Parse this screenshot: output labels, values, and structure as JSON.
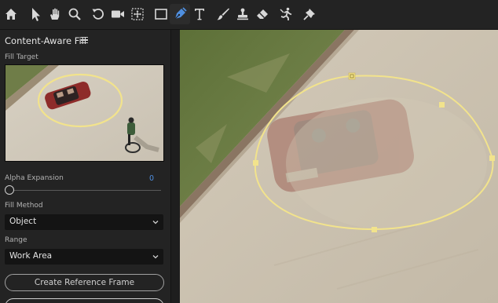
{
  "toolbar": {
    "tools": [
      {
        "name": "home-icon",
        "active": false
      },
      {
        "name": "selection-arrow-icon",
        "active": false
      },
      {
        "name": "hand-icon",
        "active": false
      },
      {
        "name": "zoom-icon",
        "active": false
      },
      {
        "name": "rotate-icon",
        "active": false
      },
      {
        "name": "camera-icon",
        "active": false
      },
      {
        "name": "pan-behind-icon",
        "active": false
      },
      {
        "name": "rectangle-icon",
        "active": false
      },
      {
        "name": "pen-icon",
        "active": true
      },
      {
        "name": "type-icon",
        "active": false
      },
      {
        "name": "brush-icon",
        "active": false
      },
      {
        "name": "clone-stamp-icon",
        "active": false
      },
      {
        "name": "eraser-icon",
        "active": false
      },
      {
        "name": "roto-brush-icon",
        "active": false
      },
      {
        "name": "puppet-pin-icon",
        "active": false
      }
    ],
    "active_color": "#4f8fe0"
  },
  "panel": {
    "title": "Content-Aware Fill",
    "fill_target_label": "Fill Target",
    "alpha_expansion_label": "Alpha Expansion",
    "alpha_expansion_value": "0",
    "fill_method_label": "Fill Method",
    "fill_method_value": "Object",
    "range_label": "Range",
    "range_value": "Work Area",
    "create_reference_frame_label": "Create Reference Frame"
  },
  "viewer": {
    "mask_color": "#f2e38c"
  }
}
